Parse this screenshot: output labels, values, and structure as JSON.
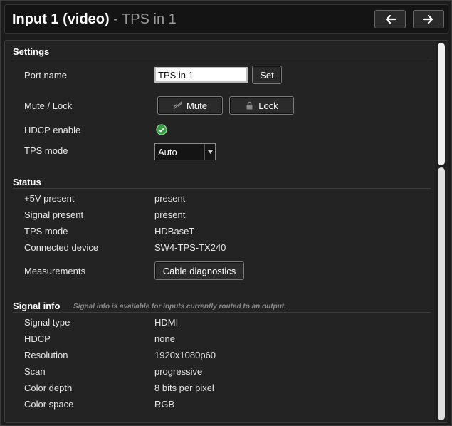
{
  "header": {
    "title_main": "Input 1 (video)",
    "title_sep": " - ",
    "title_sub": "TPS in 1",
    "prev_icon": "arrow-left-icon",
    "next_icon": "arrow-right-icon"
  },
  "settings": {
    "title": "Settings",
    "port_name": {
      "label": "Port name",
      "value": "TPS in 1",
      "button": "Set"
    },
    "mute_lock": {
      "label": "Mute / Lock",
      "mute_button": "Mute",
      "lock_button": "Lock",
      "mute_icon": "mute-icon",
      "lock_icon": "lock-icon"
    },
    "hdcp_enable": {
      "label": "HDCP enable",
      "icon": "check-circle-icon",
      "enabled": true
    },
    "tps_mode": {
      "label": "TPS mode",
      "selected": "Auto",
      "icon": "chevron-down-icon"
    }
  },
  "status": {
    "title": "Status",
    "rows": [
      {
        "label": "+5V present",
        "value": "present"
      },
      {
        "label": "Signal present",
        "value": "present"
      },
      {
        "label": "TPS mode",
        "value": "HDBaseT"
      },
      {
        "label": "Connected device",
        "value": "SW4-TPS-TX240"
      }
    ],
    "measurements": {
      "label": "Measurements",
      "button": "Cable diagnostics"
    }
  },
  "signal_info": {
    "title": "Signal info",
    "note": "Signal info is available for inputs currently routed to an output.",
    "rows": [
      {
        "label": "Signal type",
        "value": "HDMI"
      },
      {
        "label": "HDCP",
        "value": "none"
      },
      {
        "label": "Resolution",
        "value": "1920x1080p60"
      },
      {
        "label": "Scan",
        "value": "progressive"
      },
      {
        "label": "Color depth",
        "value": "8 bits per pixel"
      },
      {
        "label": "Color space",
        "value": "RGB"
      }
    ]
  },
  "colors": {
    "background": "#1c1c1c",
    "panel": "#232323",
    "accent_green": "#2e9e3e",
    "text": "#ffffff",
    "muted_text": "#9a9a9a"
  }
}
